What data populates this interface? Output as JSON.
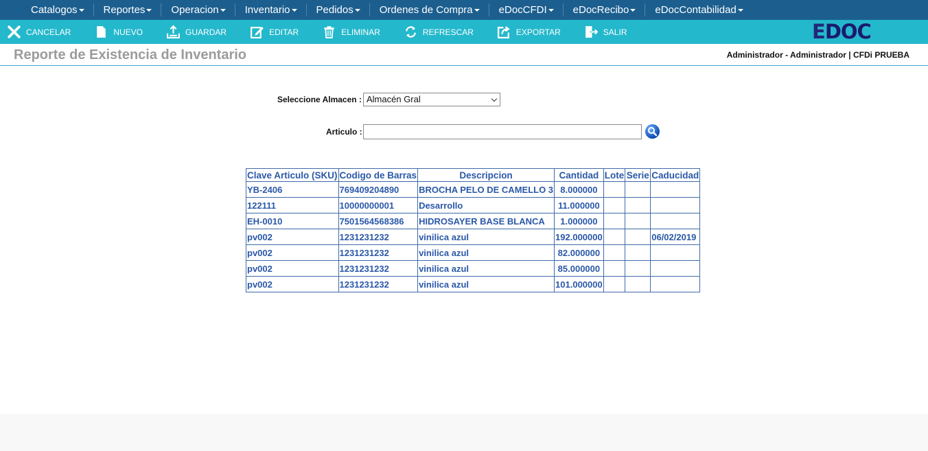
{
  "nav": {
    "items": [
      {
        "label": "Catalogos"
      },
      {
        "label": "Reportes"
      },
      {
        "label": "Operacion"
      },
      {
        "label": "Inventario"
      },
      {
        "label": "Pedidos"
      },
      {
        "label": "Ordenes de Compra"
      },
      {
        "label": "eDocCFDI"
      },
      {
        "label": "eDocRecibo"
      },
      {
        "label": "eDocContabilidad"
      }
    ]
  },
  "toolbar": {
    "cancelar": "CANCELAR",
    "nuevo": "NUEVO",
    "guardar": "GUARDAR",
    "editar": "EDITAR",
    "eliminar": "ELIMINAR",
    "refrescar": "REFRESCAR",
    "exportar": "EXPORTAR",
    "salir": "SALIR"
  },
  "logo": {
    "first": "E",
    "rest": "DOC"
  },
  "header": {
    "title": "Reporte de Existencia de Inventario",
    "user": "Administrador - Administrador | CFDi PRUEBA"
  },
  "form": {
    "almacen_label": "Seleccione Almacen :",
    "almacen_value": "Almacén Gral",
    "articulo_label": "Articulo :",
    "articulo_value": ""
  },
  "table": {
    "headers": [
      "Clave Articulo (SKU)",
      "Codigo de Barras",
      "Descripcion",
      "Cantidad",
      "Lote",
      "Serie",
      "Caducidad"
    ],
    "rows": [
      [
        "YB-2406",
        "769409204890",
        "BROCHA PELO DE CAMELLO 3",
        "8.000000",
        "",
        "",
        ""
      ],
      [
        "122111",
        "10000000001",
        "Desarrollo",
        "11.000000",
        "",
        "",
        ""
      ],
      [
        "EH-0010",
        "7501564568386",
        "HIDROSAYER BASE BLANCA",
        "1.000000",
        "",
        "",
        ""
      ],
      [
        "pv002",
        "1231231232",
        "vinilica azul",
        "192.000000",
        "",
        "",
        "06/02/2019"
      ],
      [
        "pv002",
        "1231231232",
        "vinilica azul",
        "82.000000",
        "",
        "",
        ""
      ],
      [
        "pv002",
        "1231231232",
        "vinilica azul",
        "85.000000",
        "",
        "",
        ""
      ],
      [
        "pv002",
        "1231231232",
        "vinilica azul",
        "101.000000",
        "",
        "",
        ""
      ]
    ]
  }
}
